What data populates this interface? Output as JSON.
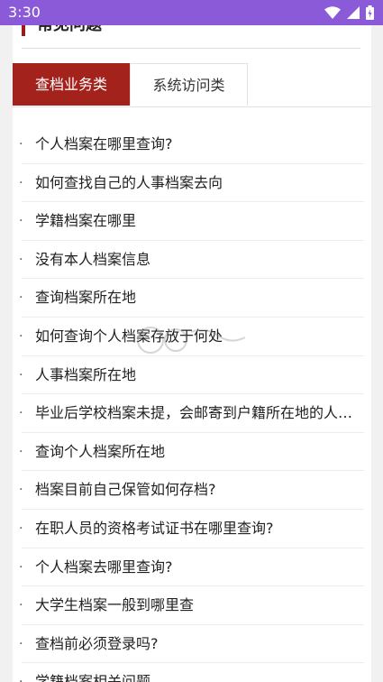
{
  "status_bar": {
    "time": "3:30",
    "icons": [
      "wifi-icon",
      "signal-icon",
      "battery-icon"
    ],
    "background": "#8b5ad8"
  },
  "section": {
    "title": "常见问题",
    "accent_color": "#9b1b1b"
  },
  "tabs": [
    {
      "label": "查档业务类",
      "active": true
    },
    {
      "label": "系统访问类",
      "active": false
    }
  ],
  "tab_active_color": "#a3231c",
  "faq": {
    "bullet": "·",
    "items": [
      "个人档案在哪里查询?",
      "如何查找自己的人事档案去向",
      "学籍档案在哪里",
      "没有本人档案信息",
      "查询档案所在地",
      "如何查询个人档案存放于何处",
      "人事档案所在地",
      "毕业后学校档案未提，会邮寄到户籍所在地的人才中心吗?",
      "查询个人档案所在地",
      "档案目前自己保管如何存档?",
      "在职人员的资格考试证书在哪里查询?",
      "个人档案去哪里查询?",
      "大学生档案一般到哪里查",
      "查档前必须登录吗?",
      "学籍档案相关问题"
    ]
  }
}
